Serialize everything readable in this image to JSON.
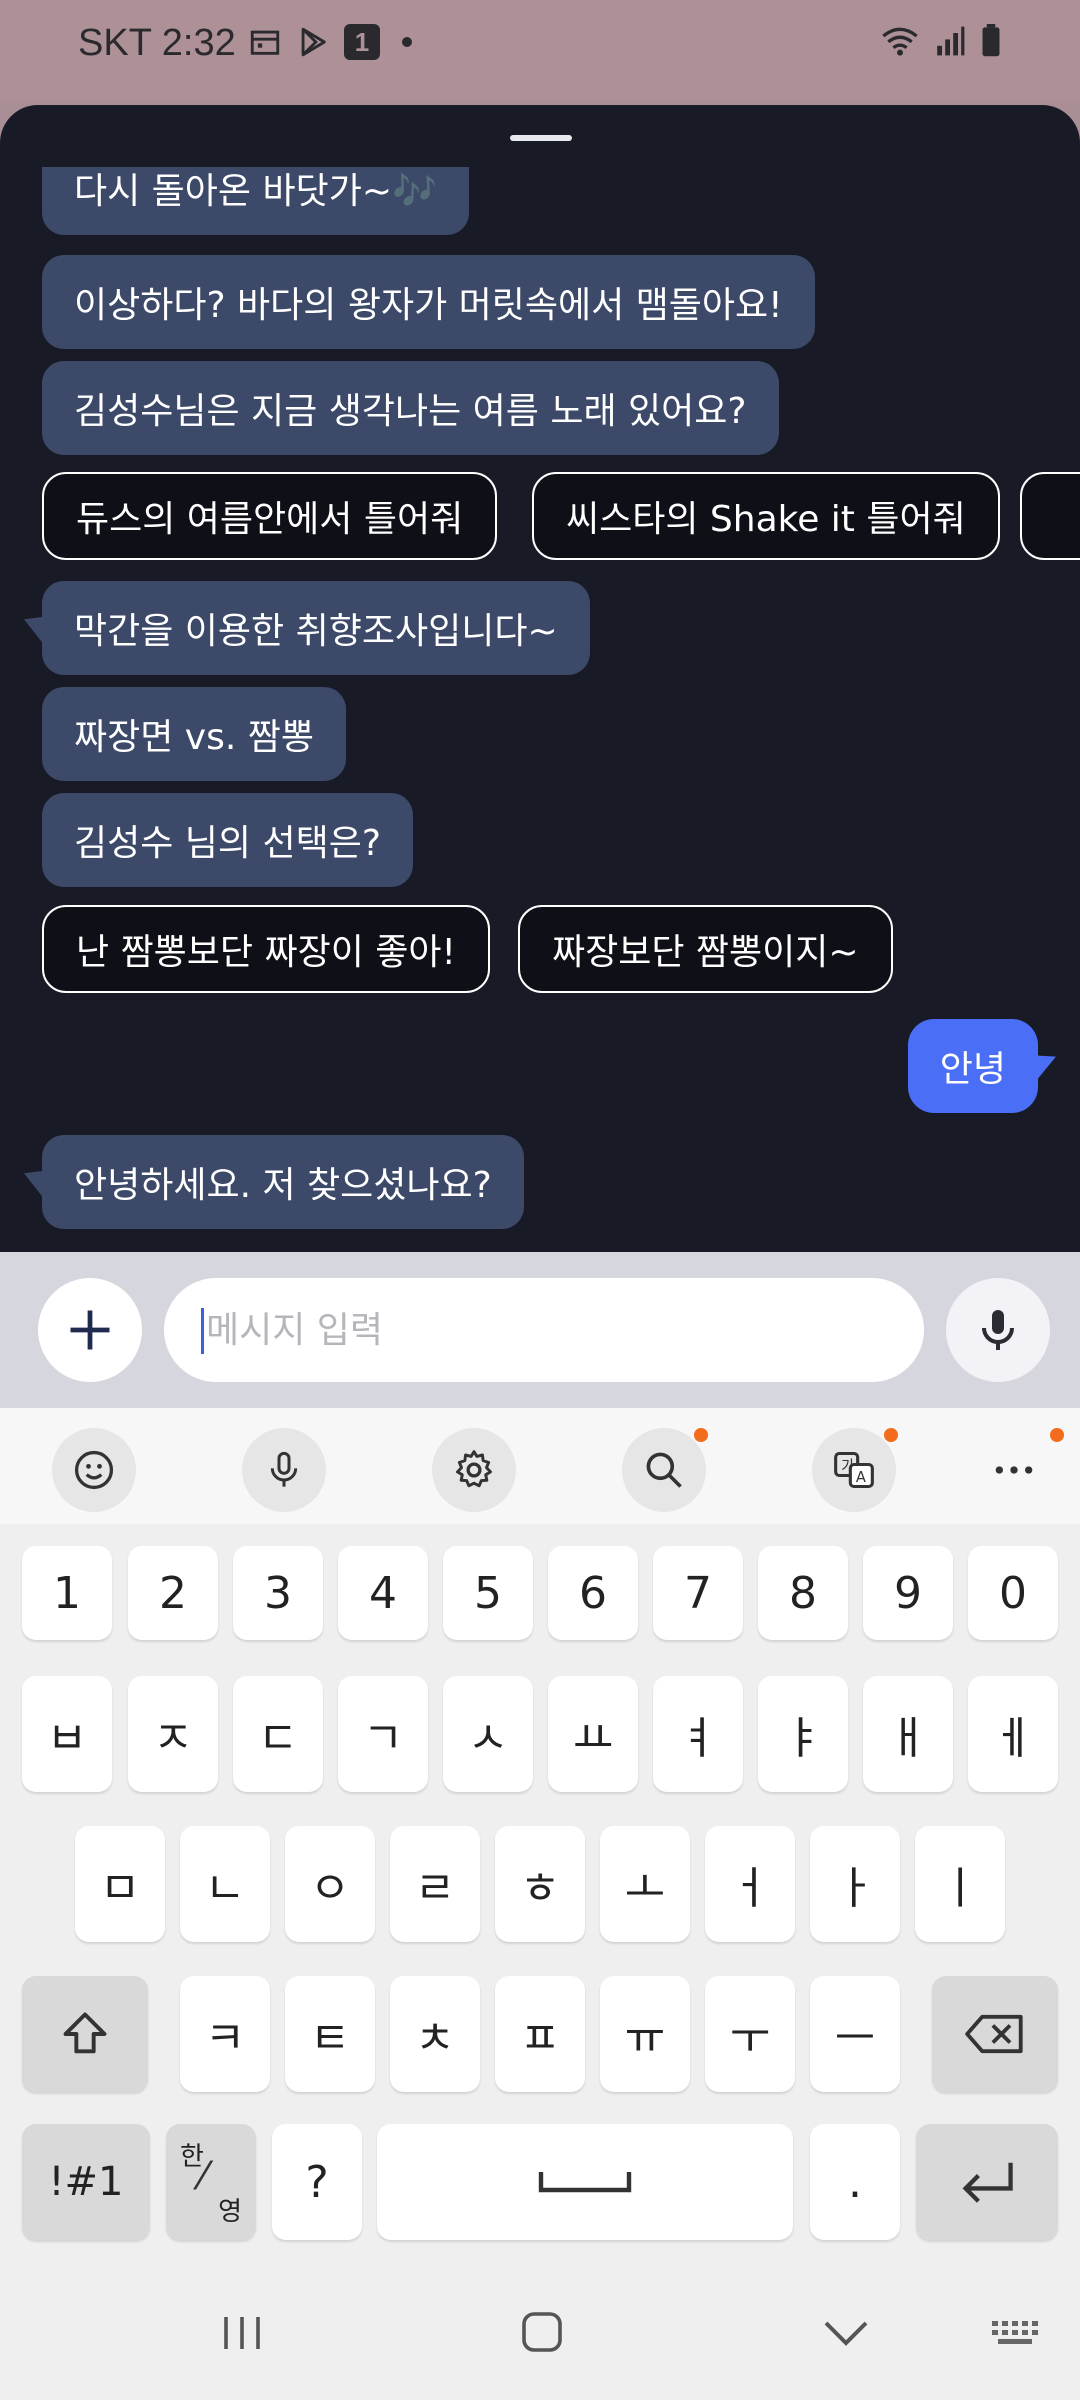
{
  "status": {
    "carrier_time": "SKT 2:32"
  },
  "chat": {
    "bot_messages_top": [
      "다시 돌아온 바닷가~🎶",
      "이상하다? 바다의 왕자가 머릿속에서 맴돌아요!",
      "김성수님은 지금 생각나는 여름 노래 있어요?"
    ],
    "chips_1": [
      "듀스의 여름안에서 틀어줘",
      "씨스타의 Shake it 틀어줘"
    ],
    "bot_messages_mid": [
      "막간을 이용한 취향조사입니다~",
      "짜장면 vs. 짬뽕",
      "김성수 님의 선택은?"
    ],
    "chips_2": [
      "난 짬뽕보단 짜장이 좋아!",
      "짜장보단 짬뽕이지~"
    ],
    "user_message": "안녕",
    "bot_reply": "안녕하세요. 저 찾으셨나요?"
  },
  "input": {
    "placeholder": "메시지 입력"
  },
  "keyboard": {
    "row_numbers": [
      "1",
      "2",
      "3",
      "4",
      "5",
      "6",
      "7",
      "8",
      "9",
      "0"
    ],
    "row_1": [
      "ㅂ",
      "ㅈ",
      "ㄷ",
      "ㄱ",
      "ㅅ",
      "ㅛ",
      "ㅕ",
      "ㅑ",
      "ㅐ",
      "ㅔ"
    ],
    "row_2": [
      "ㅁ",
      "ㄴ",
      "ㅇ",
      "ㄹ",
      "ㅎ",
      "ㅗ",
      "ㅓ",
      "ㅏ",
      "ㅣ"
    ],
    "row_3": [
      "ㅋ",
      "ㅌ",
      "ㅊ",
      "ㅍ",
      "ㅠ",
      "ㅜ",
      "ㅡ"
    ],
    "symbols_key": "!#1",
    "lang_key_top": "한",
    "lang_key_bottom": "영",
    "question_key": "?",
    "period_key": "."
  },
  "colors": {
    "sheet_bg": "#181a26",
    "bot_bubble": "#3c4968",
    "user_bubble": "#4a6ef5",
    "notification_dot": "#f36b1c"
  }
}
